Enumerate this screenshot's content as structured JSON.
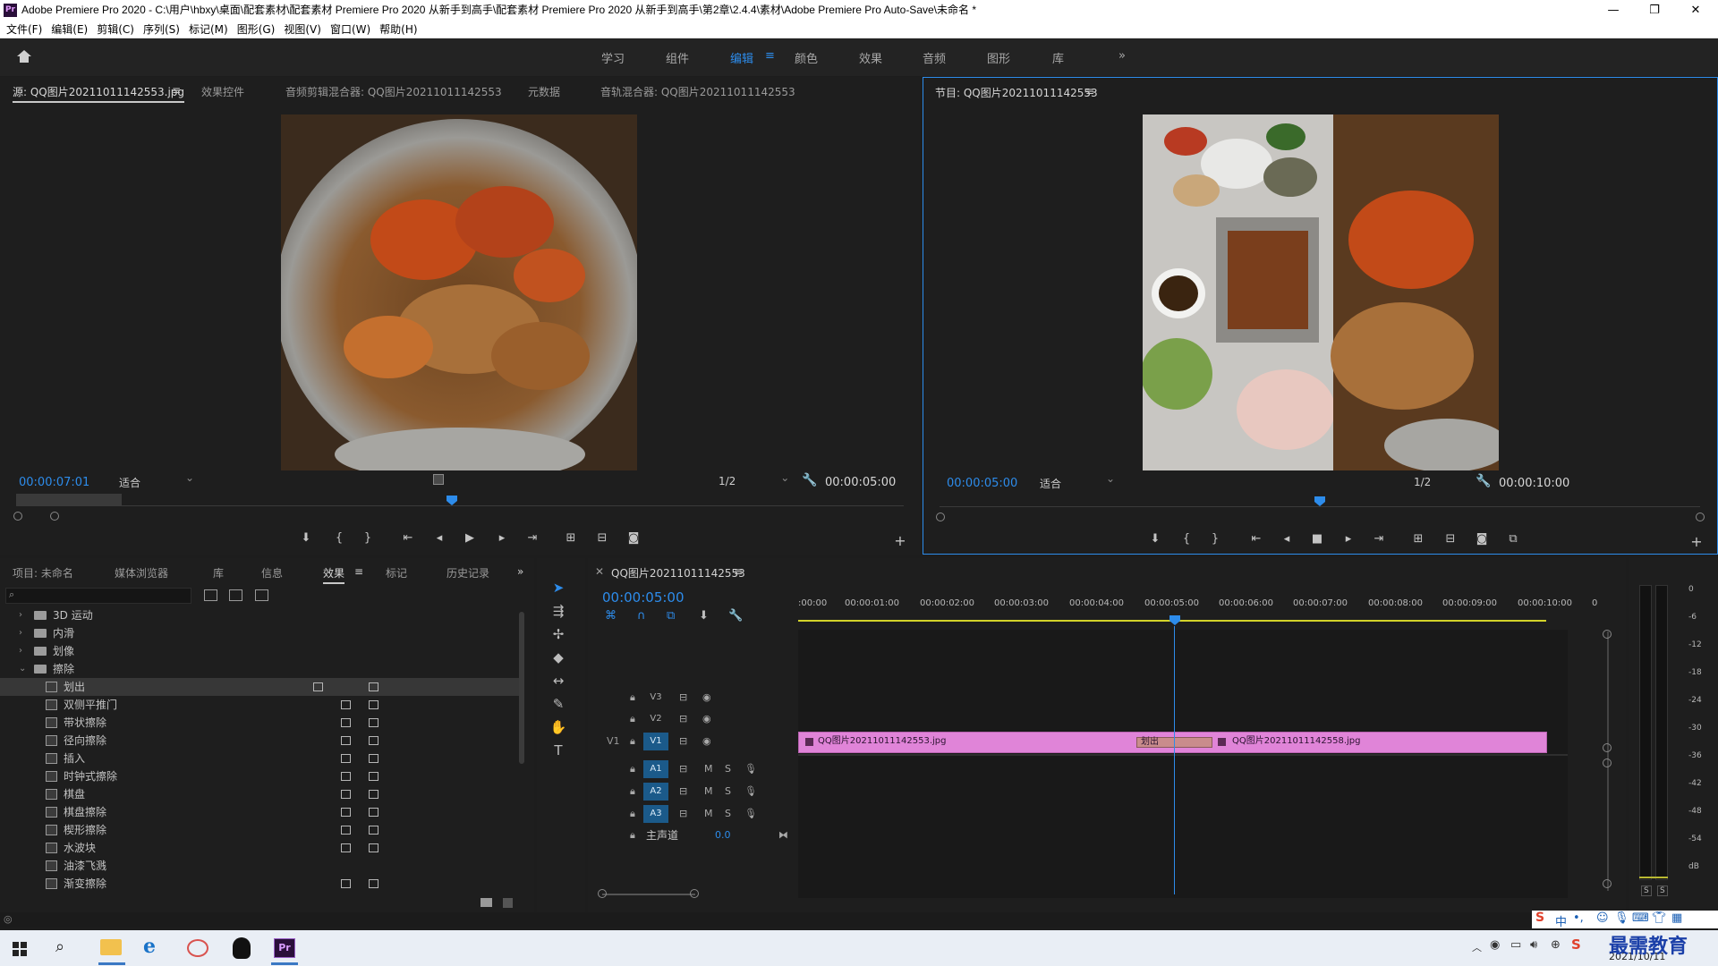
{
  "window": {
    "title": "Adobe Premiere Pro 2020 - C:\\用户\\hbxy\\桌面\\配套素材\\配套素材 Premiere Pro 2020 从新手到高手\\配套素材 Premiere Pro 2020 从新手到高手\\第2章\\2.4.4\\素材\\Adobe Premiere Pro Auto-Save\\未命名 *",
    "app_badge": "Pr",
    "controls": [
      "—",
      "❐",
      "✕"
    ]
  },
  "menu": [
    "文件(F)",
    "编辑(E)",
    "剪辑(C)",
    "序列(S)",
    "标记(M)",
    "图形(G)",
    "视图(V)",
    "窗口(W)",
    "帮助(H)"
  ],
  "workspaces": {
    "items": [
      "学习",
      "组件",
      "编辑",
      "颜色",
      "效果",
      "音频",
      "图形",
      "库"
    ],
    "active": "编辑",
    "overflow": "»",
    "menu_glyph": "≡"
  },
  "source_panel": {
    "tabs": [
      "源: QQ图片20211011142553.jpg",
      "效果控件",
      "音频剪辑混合器: QQ图片20211011142553",
      "元数据",
      "音轨混合器: QQ图片20211011142553"
    ],
    "timecode": "00:00:07:01",
    "fit": "适合",
    "resolution": "1/2",
    "duration": "00:00:05:00"
  },
  "program_panel": {
    "tab": "节目: QQ图片20211011142553",
    "timecode": "00:00:05:00",
    "fit": "适合",
    "resolution": "1/2",
    "duration": "00:00:10:00"
  },
  "project_panel": {
    "tabs": [
      "项目: 未命名",
      "媒体浏览器",
      "库",
      "信息",
      "效果",
      "标记",
      "历史记录"
    ],
    "active_tab": "效果",
    "folders": [
      "3D 运动",
      "内滑",
      "划像",
      "擦除"
    ],
    "effects": [
      "划出",
      "双侧平推门",
      "带状擦除",
      "径向擦除",
      "插入",
      "时钟式擦除",
      "棋盘",
      "棋盘擦除",
      "楔形擦除",
      "水波块",
      "油漆飞溅",
      "渐变擦除"
    ]
  },
  "timeline": {
    "tab": "QQ图片20211011142553",
    "timecode": "00:00:05:00",
    "ruler": ":00:00",
    "ticks": [
      "00:00:01:00",
      "00:00:02:00",
      "00:00:03:00",
      "00:00:04:00",
      "00:00:05:00",
      "00:00:06:00",
      "00:00:07:00",
      "00:00:08:00",
      "00:00:09:00",
      "00:00:10:00",
      "0"
    ],
    "video_tracks": [
      "V3",
      "V2",
      "V1"
    ],
    "audio_tracks": [
      "A1",
      "A2",
      "A3"
    ],
    "source_patch": "V1",
    "mute_label": "M",
    "solo_label": "S",
    "master": {
      "label": "主声道",
      "value": "0.0"
    },
    "clip1": "QQ图片20211011142553.jpg",
    "transition": "划出",
    "clip2": "QQ图片20211011142558.jpg"
  },
  "audio_meter": {
    "scale": [
      "0",
      "-6",
      "-12",
      "-18",
      "-24",
      "-30",
      "-36",
      "-42",
      "-48",
      "-54",
      "dB"
    ],
    "solo": [
      "S",
      "S"
    ]
  },
  "taskbar": {
    "ime": "中",
    "date": "2021/10/11",
    "watermark": "最需教育"
  },
  "colors": {
    "accent": "#2d8ceb",
    "clip": "#e084d8",
    "playhead": "#2d8ceb",
    "taskbar": "#e9eef5"
  }
}
